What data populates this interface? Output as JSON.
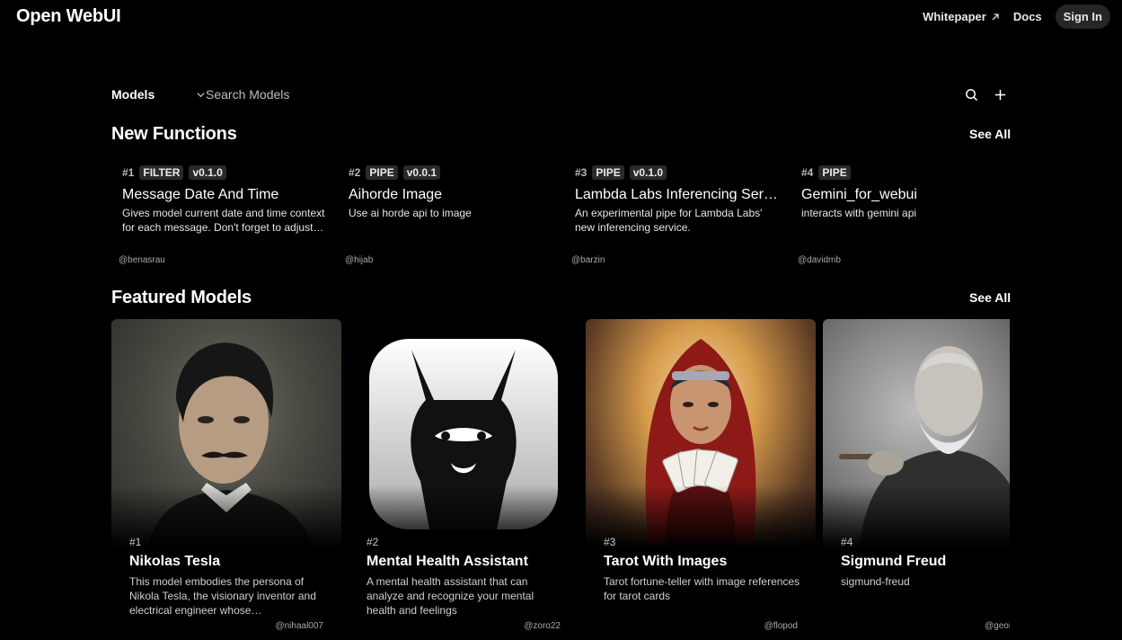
{
  "nav": {
    "brand": "Open WebUI",
    "whitepaper": "Whitepaper",
    "docs": "Docs",
    "sign_in": "Sign In"
  },
  "search": {
    "select_value": "Models",
    "placeholder": "Search Models"
  },
  "functions": {
    "title": "New Functions",
    "see_all": "See All",
    "items": [
      {
        "rank": "#1",
        "type": "FILTER",
        "version": "v0.1.0",
        "name": "Message Date And Time",
        "desc": "Gives model current date and time context for each message. Don't forget to adjust the timezone in the settings.",
        "author": "@benasrau"
      },
      {
        "rank": "#2",
        "type": "PIPE",
        "version": "v0.0.1",
        "name": "Aihorde Image",
        "desc": "Use ai horde api to image",
        "author": "@hijab"
      },
      {
        "rank": "#3",
        "type": "PIPE",
        "version": "v0.1.0",
        "name": "Lambda Labs Inferencing Service",
        "desc": "An experimental pipe for Lambda Labs' new inferencing service.",
        "author": "@barzin"
      },
      {
        "rank": "#4",
        "type": "PIPE",
        "version": "",
        "name": "Gemini_for_webui",
        "desc": "interacts with gemini api",
        "author": "@davidmb"
      }
    ]
  },
  "models": {
    "title": "Featured Models",
    "see_all": "See All",
    "items": [
      {
        "rank": "#1",
        "name": "Nikolas Tesla",
        "desc": "This model embodies the persona of Nikola Tesla, the visionary inventor and electrical engineer whose groundbreaking work shaped the modern world.",
        "author": "@nihaal007"
      },
      {
        "rank": "#2",
        "name": "Mental Health Assistant",
        "desc": "A mental health assistant that can analyze and recognize your mental health and feelings",
        "author": "@zoro22"
      },
      {
        "rank": "#3",
        "name": "Tarot With Images",
        "desc": "Tarot fortune-teller with image references for tarot cards",
        "author": "@flopod"
      },
      {
        "rank": "#4",
        "name": "Sigmund Freud",
        "desc": "sigmund-freud",
        "author": "@geoi"
      }
    ]
  }
}
